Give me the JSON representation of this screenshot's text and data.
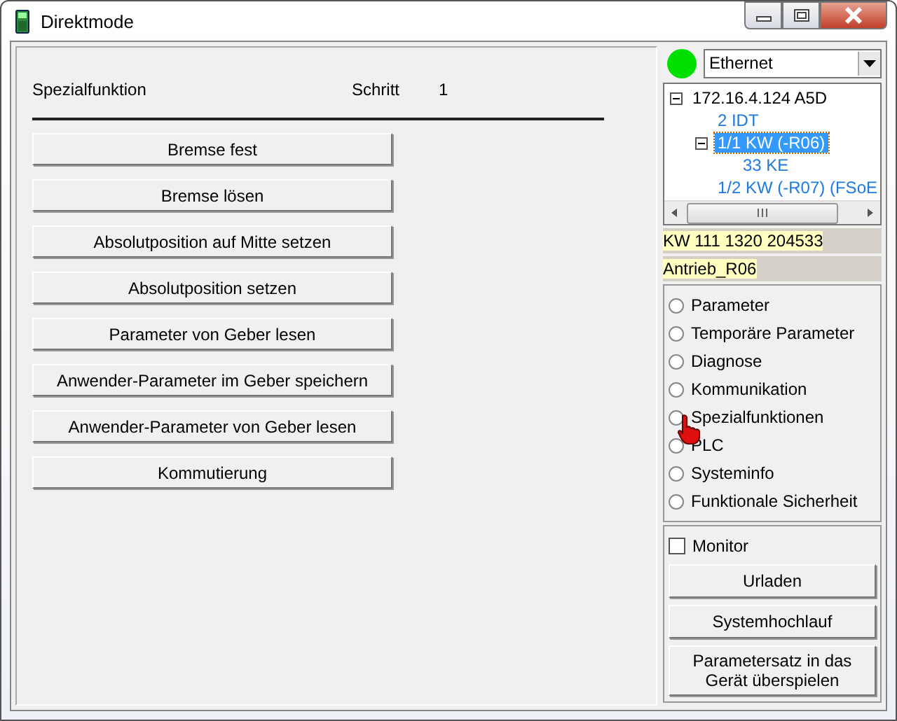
{
  "window": {
    "title": "Direktmode"
  },
  "header": {
    "title": "Spezialfunktion",
    "step_label": "Schritt",
    "step_value": "1"
  },
  "actions": [
    "Bremse fest",
    "Bremse lösen",
    "Absolutposition auf Mitte setzen",
    "Absolutposition setzen",
    "Parameter von Geber lesen",
    "Anwender-Parameter im Geber speichern",
    "Anwender-Parameter von Geber lesen",
    "Kommutierung"
  ],
  "connection": {
    "online": true,
    "value": "Ethernet"
  },
  "tree": [
    {
      "label": "172.16.4.124  A5D",
      "expanded": true,
      "selected": false,
      "children": [
        {
          "label": "2 IDT",
          "selected": false
        },
        {
          "label": "1/1  KW (-R06)",
          "expanded": true,
          "selected": true,
          "children": [
            {
              "label": "33 KE",
              "selected": false
            }
          ]
        },
        {
          "label": "1/2  KW (-R07) (FSoE",
          "selected": false
        }
      ]
    }
  ],
  "device_info": [
    "KW  111 1320 204533",
    "Antrieb_R06"
  ],
  "modes": [
    {
      "label": "Parameter",
      "selected": false
    },
    {
      "label": "Temporäre Parameter",
      "selected": false
    },
    {
      "label": "Diagnose",
      "selected": false
    },
    {
      "label": "Kommunikation",
      "selected": false
    },
    {
      "label": "Spezialfunktionen",
      "selected": false
    },
    {
      "label": "PLC",
      "selected": false
    },
    {
      "label": "Systeminfo",
      "selected": false
    },
    {
      "label": "Funktionale Sicherheit",
      "selected": false
    }
  ],
  "monitor": {
    "label": "Monitor",
    "checked": false
  },
  "side_buttons": [
    "Urladen",
    "Systemhochlauf",
    "Parametersatz in das Gerät überspielen"
  ]
}
